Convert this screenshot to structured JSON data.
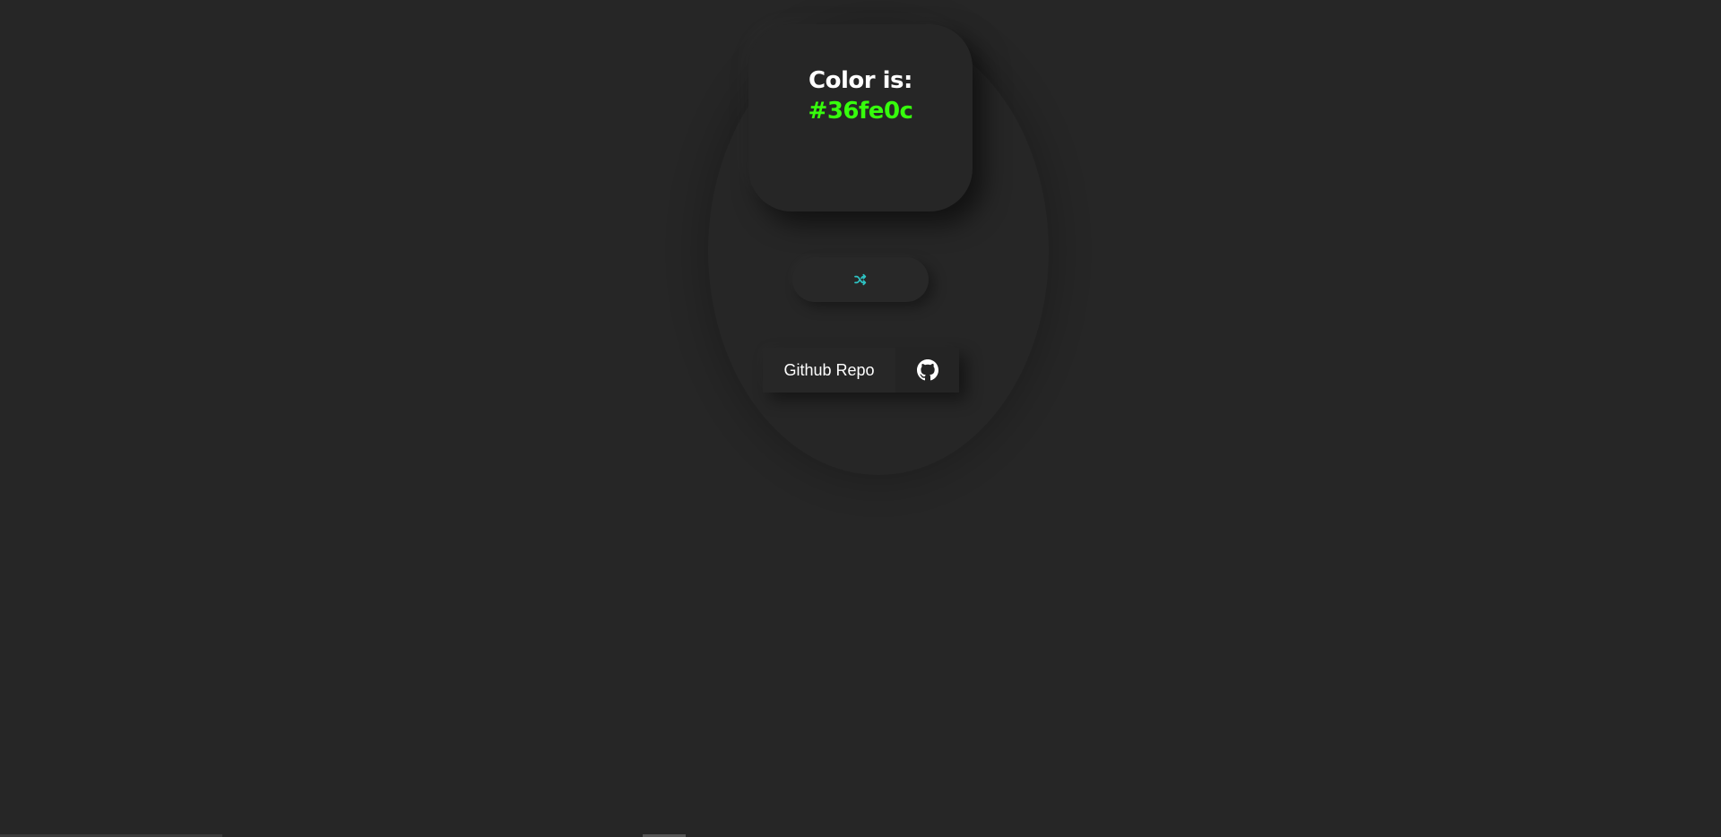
{
  "color_card": {
    "label": "Color is:",
    "value": "#36fe0c"
  },
  "shuffle_button": {
    "icon": "shuffle-icon",
    "icon_color": "#2ec4c4"
  },
  "github_button": {
    "label": "Github Repo",
    "icon": "github-icon"
  },
  "colors": {
    "background": "#262626",
    "accent": "#36fe0c",
    "text": "#ffffff"
  }
}
